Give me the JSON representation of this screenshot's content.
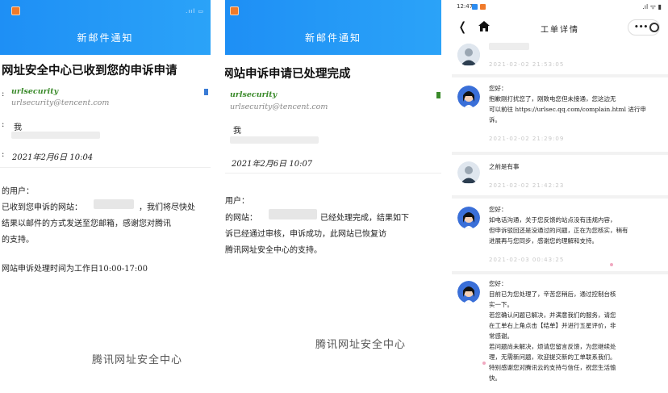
{
  "panel1": {
    "header_title": "新邮件通知",
    "subject": "网址安全中心已收到您的申诉申请",
    "sender_name": "urlsecurity",
    "sender_email": "urlsecurity@tencent.com",
    "to_prefix": ":",
    "to_label": "我",
    "date_prefix": ":",
    "date": "2021年2月6日 10:04",
    "greeting": "的用户：",
    "body_lines": [
      "已收到您申诉的网站：",
      "，我们将尽快处",
      "结果以邮件的方式发送至您邮箱，感谢您对腾讯",
      "的支持。"
    ],
    "hours": "网站申诉处理时间为工作日10:00-17:00",
    "signature": "腾讯网址安全中心"
  },
  "panel2": {
    "header_title": "新邮件通知",
    "subject": "网站申诉申请已处理完成",
    "sender_name": "urlsecurity",
    "sender_email": "urlsecurity@tencent.com",
    "to_label": "我",
    "date": "2021年2月6日 10:07",
    "greeting": "用户：",
    "body_lines": [
      "的网站：",
      "已经处理完成，结果如下",
      "诉已经通过审核，申诉成功，此网站已恢复访",
      "腾讯网址安全中心的支持。"
    ],
    "signature": "腾讯网址安全中心"
  },
  "panel3": {
    "status_time": "12:47",
    "nav_title": "工单详情",
    "messages": [
      {
        "lines": [],
        "timestamp": "2021-02-02 21:53:05"
      },
      {
        "lines": [
          "您好：",
          "抱歉刚打扰您了，刚致电您但未接通，您这边无",
          "可以前往 https://urlsec.qq.com/complain.html 进行申",
          "诉。"
        ],
        "timestamp": "2021-02-02 21:29:09"
      },
      {
        "lines": [
          "之前是有事"
        ],
        "timestamp": "2021-02-02 21:42:23"
      },
      {
        "lines": [
          "您好：",
          "如电话沟通，关于您反馈的站点没有违规内容，",
          "但申诉驳回还是没通过的问题，正在为您核实，稍有",
          "进展再与您同步，感谢您的理解和支持。"
        ],
        "timestamp": "2021-02-03 00:43:25"
      },
      {
        "lines": [
          "您好：",
          "目前已为您处理了，辛苦您稍后，通过控制台核",
          "实一下。",
          "若您确认问题已解决，并满意我们的服务，请您",
          "在工单右上角点击【结单】并进行五星评价，非",
          "常感谢。",
          "若问题尚未解决，烦请您留言反馈，为您继续处",
          "理，无需新问题，欢迎提交新的工单联系我们。",
          "特别感谢您对腾讯云的支持与信任，祝您生活愉",
          "快。"
        ],
        "timestamp": ""
      }
    ]
  },
  "colors": {
    "header_blue": "#1e8ff5",
    "sender_green": "#3a8a2a",
    "timestamp_grey": "#c8c8c8"
  },
  "icons": [
    "back-arrow-icon",
    "home-icon",
    "more-icon",
    "close-circle-icon",
    "app-icon",
    "bookmark-icon",
    "avatar-icon"
  ]
}
